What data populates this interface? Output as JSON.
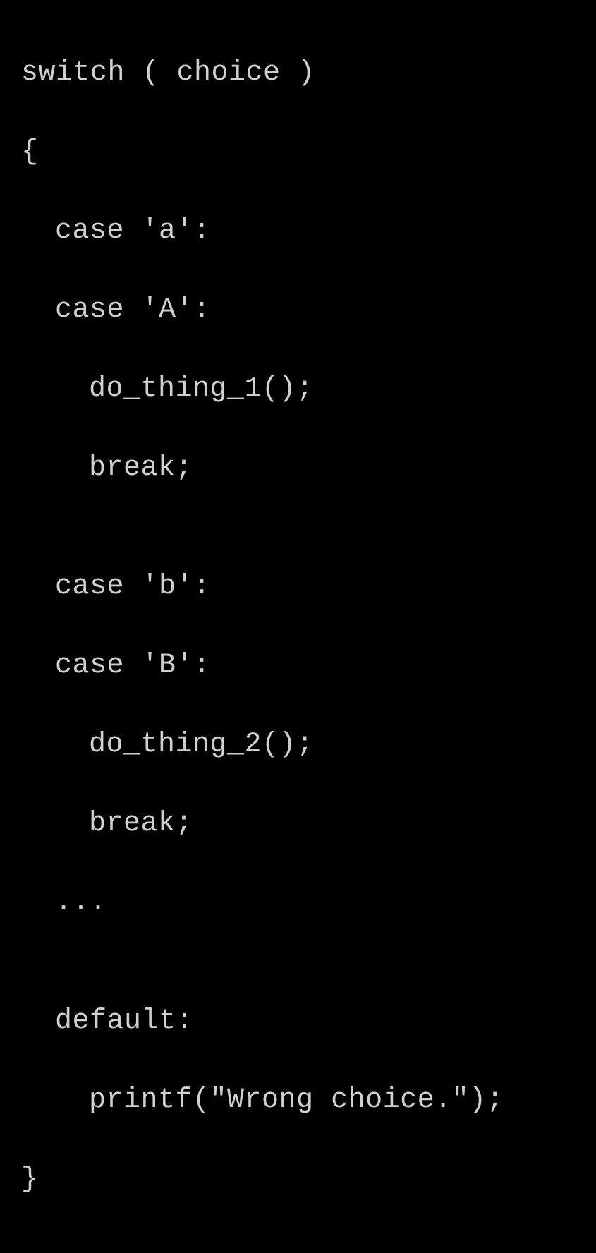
{
  "code": {
    "line1": "switch ( choice )",
    "line2": "{",
    "line3": "case 'a':",
    "line4": "case 'A':",
    "line5": "do_thing_1();",
    "line6": "break;",
    "line7": "",
    "line8": "case 'b':",
    "line9": "case 'B':",
    "line10": "do_thing_2();",
    "line11": "break;",
    "line12": "...",
    "line13": "",
    "line14": "default:",
    "line15": "printf(\"Wrong choice.\");",
    "line16": "}"
  }
}
